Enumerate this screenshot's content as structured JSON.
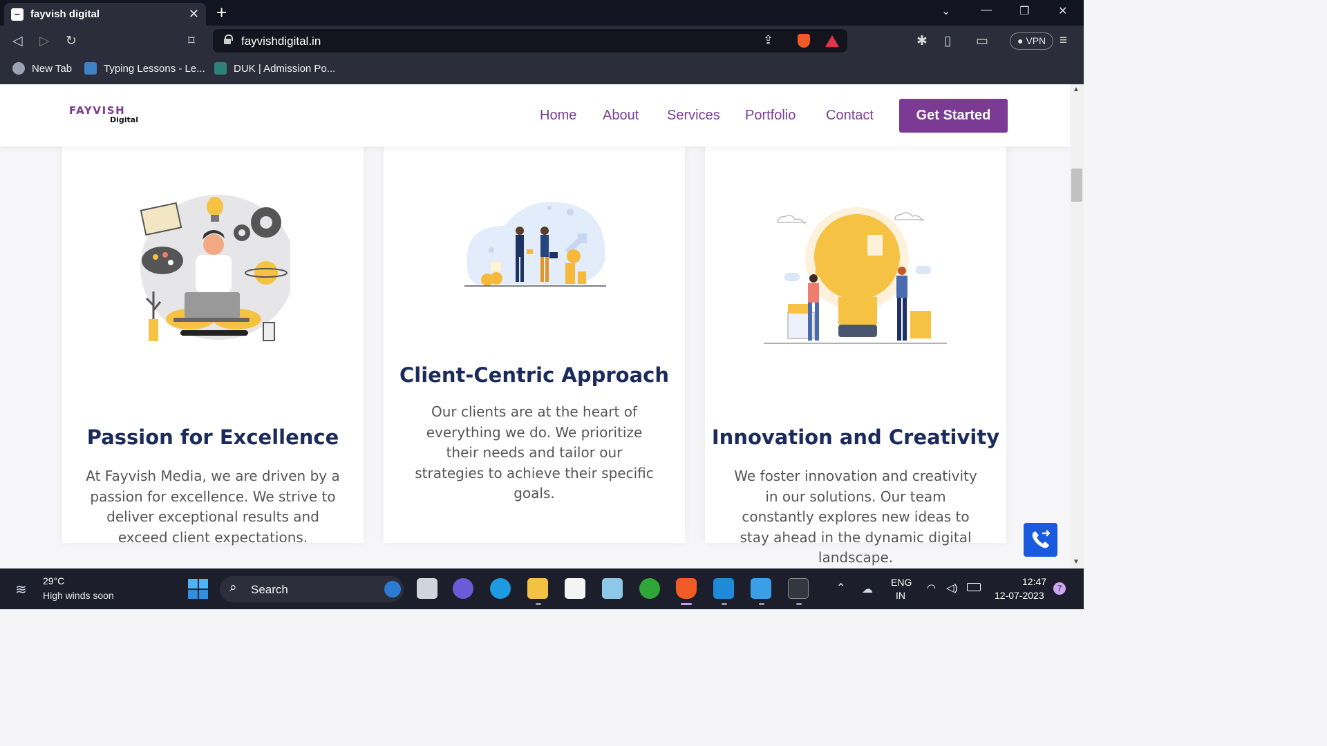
{
  "browser": {
    "tab_title": "fayvish digital",
    "url": "fayvishdigital.in",
    "vpn_label": "VPN",
    "bookmarks": [
      {
        "label": "New Tab"
      },
      {
        "label": "Typing Lessons - Le..."
      },
      {
        "label": "DUK | Admission Po..."
      }
    ]
  },
  "site": {
    "logo_top": "FAYVISH",
    "logo_bottom": "Digital",
    "nav": [
      "Home",
      "About",
      "Services",
      "Portfolio",
      "Contact"
    ],
    "cta_label": "Get Started",
    "accent_color": "#7b3a94",
    "title_color": "#1a2b5c"
  },
  "cards": [
    {
      "title": "Passion for Excellence",
      "text": "At Fayvish Media, we are driven by a passion for excellence. We strive to deliver exceptional results and exceed client expectations."
    },
    {
      "title": "Client-Centric Approach",
      "text": "Our clients are at the heart of everything we do. We prioritize their needs and tailor our strategies to achieve their specific goals."
    },
    {
      "title": "Innovation and Creativity",
      "text": "We foster innovation and creativity in our solutions. Our team constantly explores new ideas to stay ahead in the dynamic digital landscape."
    }
  ],
  "taskbar": {
    "weather_temp": "29°C",
    "weather_text": "High winds soon",
    "search_label": "Search",
    "lang_top": "ENG",
    "lang_bottom": "IN",
    "time": "12:47",
    "date": "12-07-2023",
    "notification_count": "7"
  }
}
